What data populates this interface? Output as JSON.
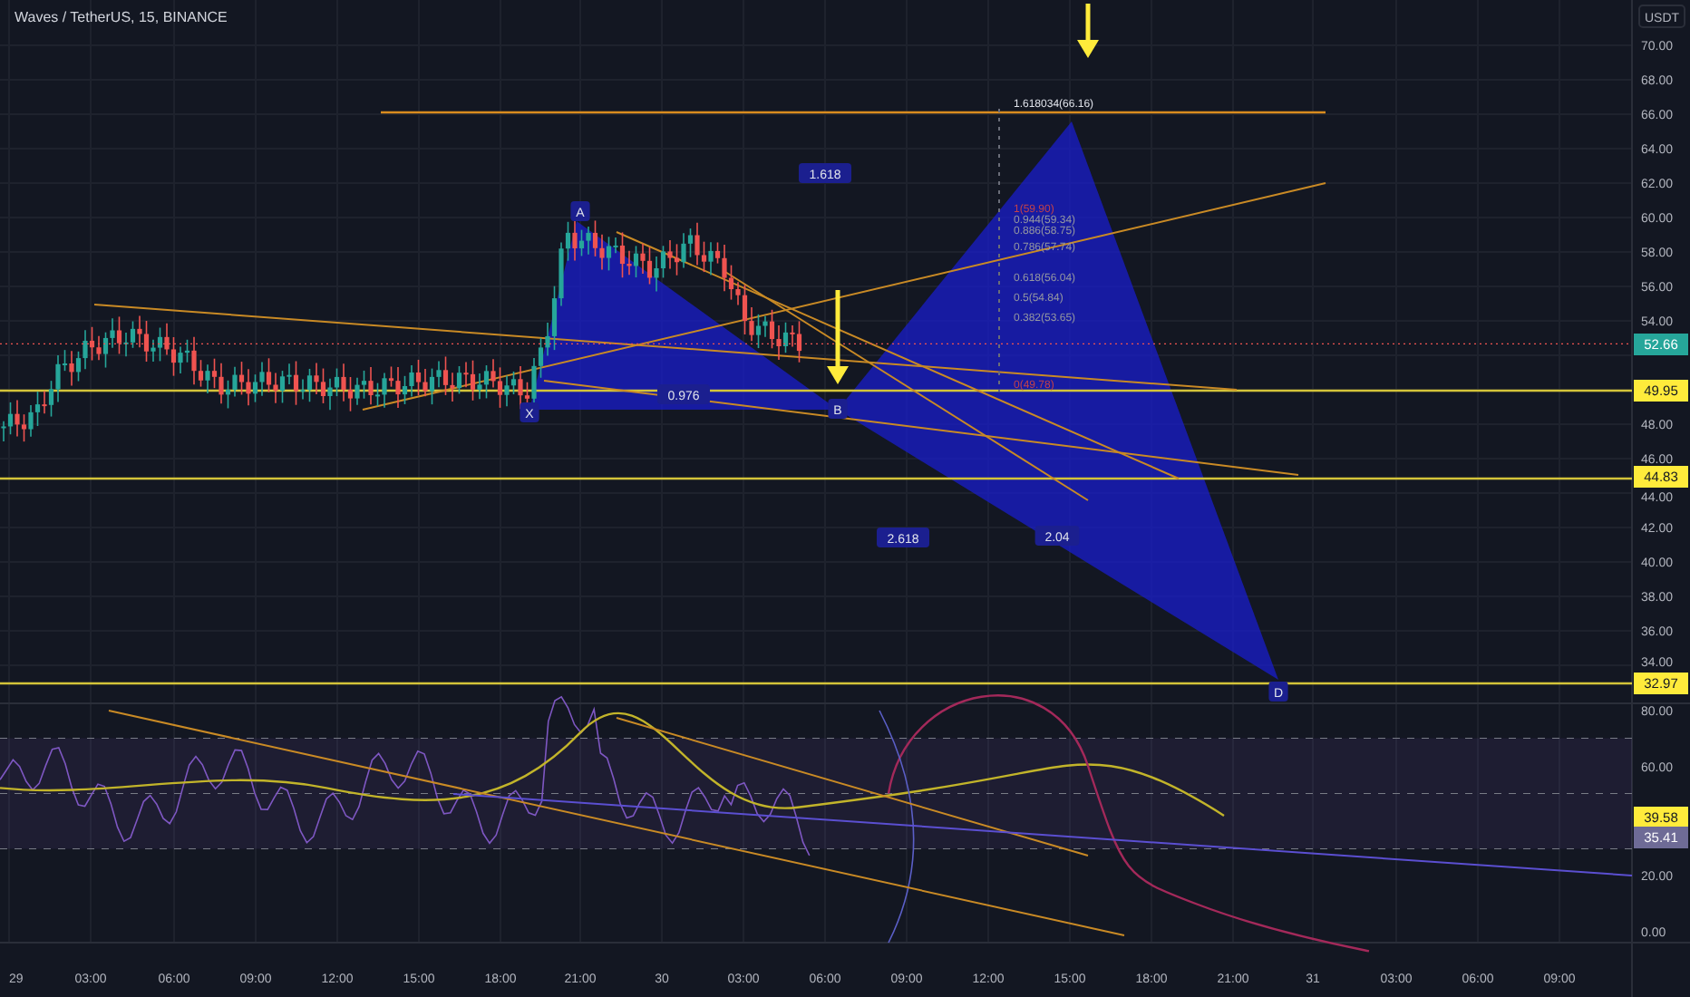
{
  "header": {
    "title": "Waves / TetherUS, 15, BINANCE",
    "currency": "USDT"
  },
  "price_axis": [
    "70.00",
    "68.00",
    "66.00",
    "64.00",
    "62.00",
    "60.00",
    "58.00",
    "56.00",
    "54.00",
    "48.00",
    "46.00",
    "44.00",
    "42.00",
    "40.00",
    "38.00",
    "36.00",
    "34.00"
  ],
  "price_tags": [
    {
      "text": "52.66",
      "color": "#26a69a"
    },
    {
      "text": "49.95",
      "color": "#ffeb3b"
    },
    {
      "text": "44.83",
      "color": "#ffeb3b"
    },
    {
      "text": "32.97",
      "color": "#ffeb3b"
    }
  ],
  "pattern": {
    "points": [
      "X",
      "A",
      "B",
      "D"
    ],
    "ratios": [
      "0.976",
      "1.618",
      "2.618",
      "2.04"
    ]
  },
  "fib_levels": [
    {
      "text": "1.618034(66.16)",
      "color": "#e0e3eb"
    },
    {
      "text": "1(59.90)",
      "color": "#c2424b"
    },
    {
      "text": "0.944(59.34)",
      "color": "#9598a1"
    },
    {
      "text": "0.886(58.75)",
      "color": "#9598a1"
    },
    {
      "text": "0.786(57.74)",
      "color": "#9598a1"
    },
    {
      "text": "0.618(56.04)",
      "color": "#9598a1"
    },
    {
      "text": "0.5(54.84)",
      "color": "#9598a1"
    },
    {
      "text": "0.382(53.65)",
      "color": "#9598a1"
    },
    {
      "text": "0(49.78)",
      "color": "#c2424b"
    }
  ],
  "rsi_axis": [
    "80.00",
    "60.00",
    "20.00",
    "0.00"
  ],
  "rsi_tags": [
    {
      "text": "39.58",
      "color": "#ffeb3b"
    },
    {
      "text": "35.41",
      "color": "#6e6b96"
    }
  ],
  "time_axis": [
    "29",
    "03:00",
    "06:00",
    "09:00",
    "12:00",
    "15:00",
    "18:00",
    "21:00",
    "30",
    "03:00",
    "06:00",
    "09:00",
    "12:00",
    "15:00",
    "18:00",
    "21:00",
    "31",
    "03:00",
    "06:00",
    "09:00"
  ]
}
